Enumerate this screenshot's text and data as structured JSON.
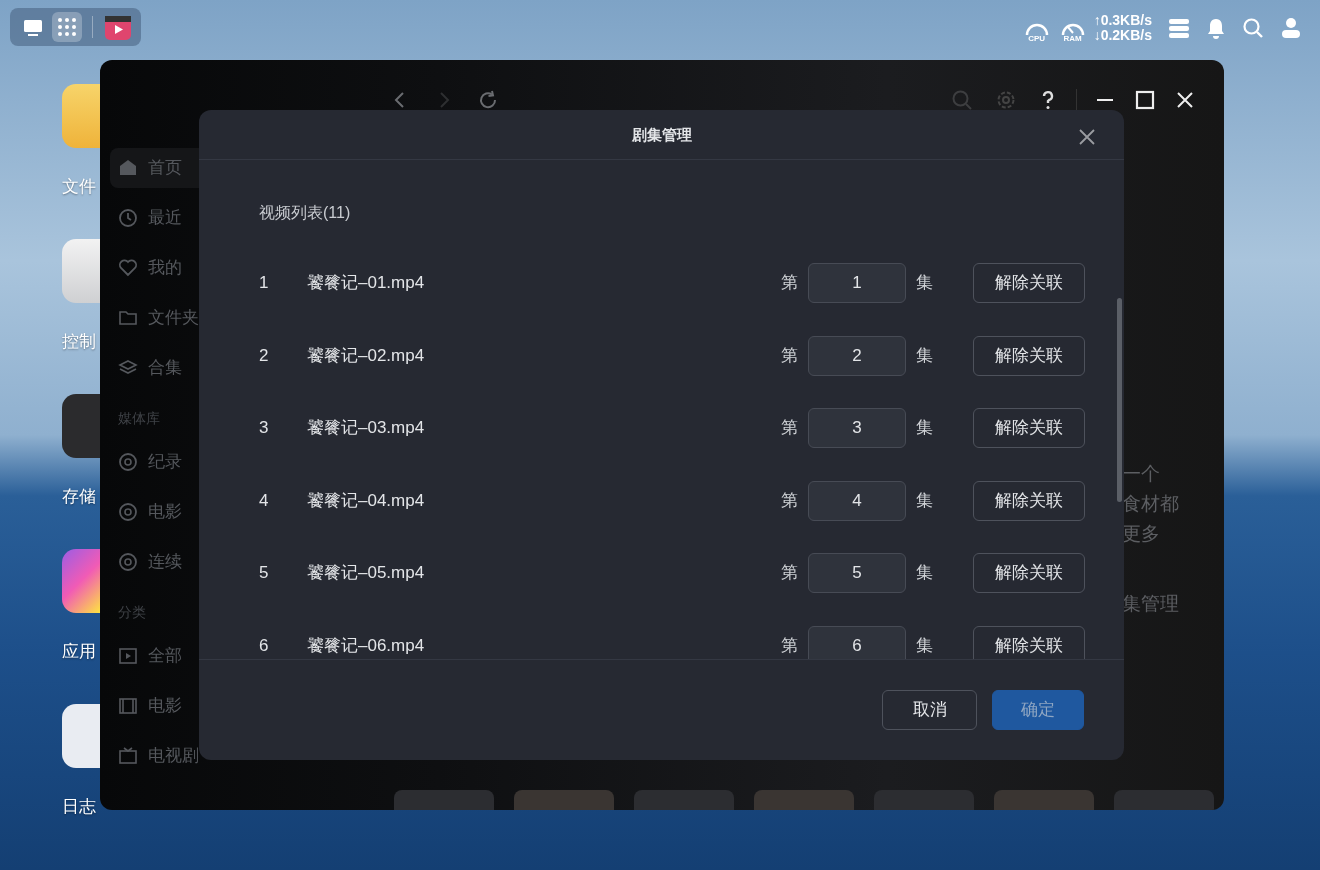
{
  "topbar": {
    "dock": [
      {
        "kind": "desktop",
        "selected": false
      },
      {
        "kind": "apps",
        "selected": true
      },
      {
        "kind": "video",
        "selected": false
      }
    ],
    "cpu_label": "CPU",
    "ram_label": "RAM",
    "upload_arrow": "↑",
    "upload": "0.3KB/s",
    "download_arrow": "↓",
    "download": "0.2KB/s"
  },
  "desktop_icons": [
    {
      "label": "文件"
    },
    {
      "label": "控制"
    },
    {
      "label": "存储"
    },
    {
      "label": "应用"
    },
    {
      "label": "日志"
    }
  ],
  "sidebar": [
    {
      "kind": "item",
      "label": "首页",
      "selected": true
    },
    {
      "kind": "item",
      "label": "最近",
      "selected": false
    },
    {
      "kind": "item",
      "label": "我的",
      "selected": false
    },
    {
      "kind": "item",
      "label": "文件夹",
      "selected": false
    },
    {
      "kind": "item",
      "label": "合集",
      "selected": false
    },
    {
      "kind": "section",
      "label": "媒体库"
    },
    {
      "kind": "item",
      "label": "纪录",
      "selected": false
    },
    {
      "kind": "item",
      "label": "电影",
      "selected": false
    },
    {
      "kind": "item",
      "label": "连续",
      "selected": false
    },
    {
      "kind": "section",
      "label": "分类"
    },
    {
      "kind": "item",
      "label": "全部",
      "selected": false
    },
    {
      "kind": "item",
      "label": "电影",
      "selected": false
    },
    {
      "kind": "item",
      "label": "电视剧",
      "selected": false
    }
  ],
  "background_text": [
    "一个",
    "食材都",
    "更多",
    "集管理"
  ],
  "modal": {
    "title": "剧集管理",
    "list_title": "视频列表(11)",
    "episodes": [
      {
        "index": "1",
        "file": "饕餮记–01.mp4",
        "prefix": "第",
        "value": "1",
        "suffix": "集",
        "action": "解除关联"
      },
      {
        "index": "2",
        "file": "饕餮记–02.mp4",
        "prefix": "第",
        "value": "2",
        "suffix": "集",
        "action": "解除关联"
      },
      {
        "index": "3",
        "file": "饕餮记–03.mp4",
        "prefix": "第",
        "value": "3",
        "suffix": "集",
        "action": "解除关联"
      },
      {
        "index": "4",
        "file": "饕餮记–04.mp4",
        "prefix": "第",
        "value": "4",
        "suffix": "集",
        "action": "解除关联"
      },
      {
        "index": "5",
        "file": "饕餮记–05.mp4",
        "prefix": "第",
        "value": "5",
        "suffix": "集",
        "action": "解除关联"
      },
      {
        "index": "6",
        "file": "饕餮记–06.mp4",
        "prefix": "第",
        "value": "6",
        "suffix": "集",
        "action": "解除关联"
      }
    ],
    "buttons": [
      {
        "label": "取消",
        "kind": "secondary"
      },
      {
        "label": "确定",
        "kind": "primary",
        "disabled": true
      }
    ]
  }
}
